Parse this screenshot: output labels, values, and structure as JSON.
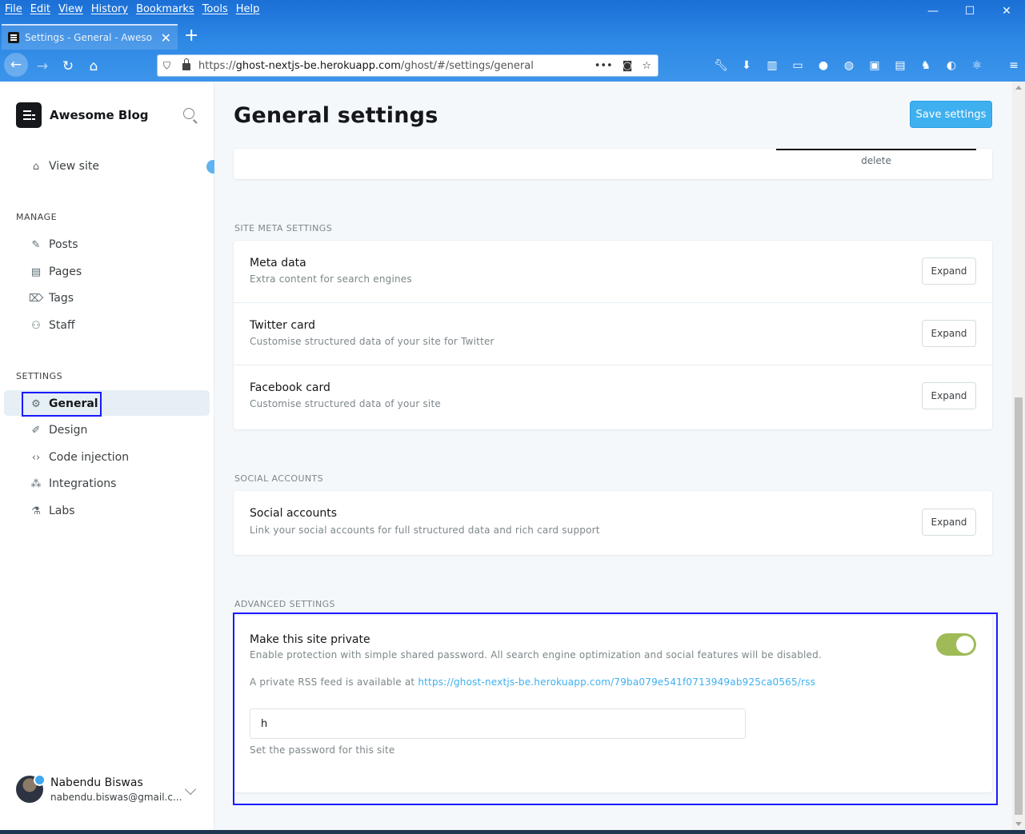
{
  "browser": {
    "menu": [
      "File",
      "Edit",
      "View",
      "History",
      "Bookmarks",
      "Tools",
      "Help"
    ],
    "tab_title": "Settings - General - Awesome Blog",
    "new_tab": "+",
    "url_host_prefix": "https://",
    "url_host": "ghost-nextjs-be.herokuapp.com",
    "url_path": "/ghost/#/settings/general",
    "url_more": "•••",
    "window_min": "—",
    "window_max": "☐",
    "window_close": "✕"
  },
  "sidebar": {
    "brand": "Awesome Blog",
    "view_site": "View site",
    "manage_header": "MANAGE",
    "manage_items": [
      "Posts",
      "Pages",
      "Tags",
      "Staff"
    ],
    "settings_header": "SETTINGS",
    "settings_items": [
      "General",
      "Design",
      "Code injection",
      "Integrations",
      "Labs"
    ],
    "user_name": "Nabendu Biswas",
    "user_email": "nabendu.biswas@gmail.c..."
  },
  "main": {
    "title": "General settings",
    "save_label": "Save settings",
    "delete_label": "delete",
    "site_meta_header": "SITE META SETTINGS",
    "meta_rows": [
      {
        "title": "Meta data",
        "desc": "Extra content for search engines",
        "button": "Expand"
      },
      {
        "title": "Twitter card",
        "desc": "Customise structured data of your site for Twitter",
        "button": "Expand"
      },
      {
        "title": "Facebook card",
        "desc": "Customise structured data of your site",
        "button": "Expand"
      }
    ],
    "social_header": "SOCIAL ACCOUNTS",
    "social_row": {
      "title": "Social accounts",
      "desc": "Link your social accounts for full structured data and rich card support",
      "button": "Expand"
    },
    "advanced_header": "ADVANCED SETTINGS",
    "private": {
      "title": "Make this site private",
      "desc": "Enable protection with simple shared password. All search engine optimization and social features will be disabled.",
      "rss_prefix": "A private RSS feed is available at",
      "rss_url": "https://ghost-nextjs-be.herokuapp.com/79ba079e541f0713949ab925ca0565/rss",
      "toggle_on": true,
      "password_value": "h",
      "password_hint": "Set the password for this site"
    }
  },
  "colors": {
    "accent": "#3eb0ef",
    "toggle_on": "#9fbb58",
    "highlight_box": "#1a1aff"
  }
}
